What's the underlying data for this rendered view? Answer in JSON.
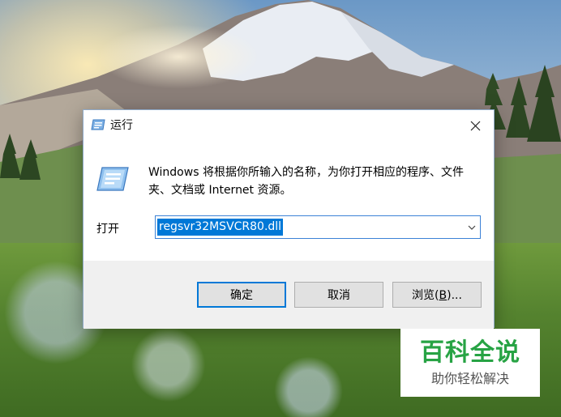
{
  "dialog": {
    "title": "运行",
    "description": "Windows 将根据你所输入的名称，为你打开相应的程序、文件夹、文档或 Internet 资源。",
    "open_label": "打开",
    "open_value": "regsvr32MSVCR80.dll",
    "buttons": {
      "ok": "确定",
      "cancel": "取消",
      "browse_prefix": "浏览(",
      "browse_accel": "B",
      "browse_suffix": ")..."
    },
    "icons": {
      "title_icon": "run-icon",
      "body_icon": "run-icon",
      "close": "close-icon",
      "dropdown": "chevron-down-icon"
    }
  },
  "watermark": {
    "title": "百科全说",
    "subtitle": "助你轻松解决"
  },
  "colors": {
    "selection": "#0078d7",
    "focus_border": "#0078d7",
    "watermark_green": "#27a344"
  }
}
